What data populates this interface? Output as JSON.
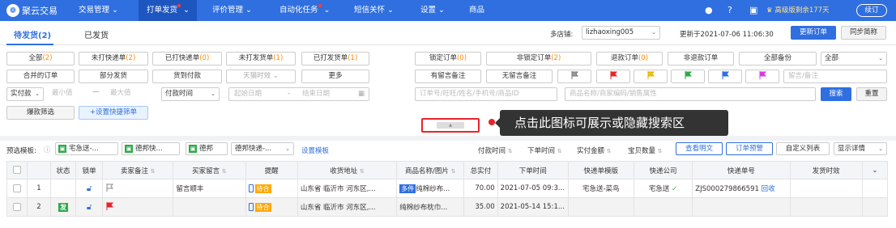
{
  "nav": {
    "logo": "聚云交易",
    "items": [
      {
        "label": "交易管理"
      },
      {
        "label": "打单发货"
      },
      {
        "label": "评价管理"
      },
      {
        "label": "自动化任务"
      },
      {
        "label": "短信关怀"
      },
      {
        "label": "设置"
      },
      {
        "label": "商品"
      }
    ],
    "promo": "高级版剩余177天",
    "renew": "续订"
  },
  "tabs": {
    "pending": "待发货(2)",
    "shipped": "已发货"
  },
  "shop": {
    "label": "多店铺:",
    "value": "lizhaoxing005",
    "updated": "更新于2021-07-06 11:06:30",
    "update_btn": "更新订单",
    "sync_btn": "同步简称"
  },
  "filters": {
    "row1_left": [
      {
        "label": "全部",
        "count": "(2)"
      },
      {
        "label": "未打快递单",
        "count": "(2)"
      },
      {
        "label": "已打快递单",
        "count": "(0)"
      },
      {
        "label": "未打发货单",
        "count": "(1)"
      },
      {
        "label": "已打发货单",
        "count": "(1)"
      }
    ],
    "row1_right": [
      {
        "label": "锁定订单",
        "count": "(0)"
      },
      {
        "label": "非锁定订单",
        "count": "(2)"
      },
      {
        "label": "退款订单",
        "count": "(0)"
      },
      {
        "label": "非退款订单",
        "count": ""
      },
      {
        "label": "全部备份",
        "count": ""
      }
    ],
    "row1_select": "全部",
    "row2_left": [
      "合并的订单",
      "部分发货",
      "货到付款",
      "天猫时效",
      "更多"
    ],
    "row2_right": [
      "有留言备注",
      "无留言备注"
    ],
    "remark_placeholder": "留言/备注",
    "actual_select": "实付款",
    "min": "最小值",
    "to": "一",
    "max": "最大值",
    "pay_time_select": "付款时间",
    "start_date": "起始日期",
    "to2": "-",
    "end_date": "结束日期",
    "order_search_placeholder": "订单号/旺旺/姓名/手机号/商品ID",
    "product_search_placeholder": "商品名称/商家编码/销售属性",
    "search_btn": "搜索",
    "reset_btn": "重置",
    "hot_filter": "爆款筛选",
    "add_quick": "+设置快捷筛单"
  },
  "tooltip": "点击此图标可展示或隐藏搜索区",
  "templates": {
    "label": "预选模板:",
    "items": [
      "宅急送-...",
      "德邦快...",
      "德邦"
    ],
    "select": "德邦快递-...",
    "setting": "设置模板"
  },
  "sort": {
    "items": [
      "付款时间",
      "下单时间",
      "实付金额",
      "宝贝数量"
    ],
    "view_plain": "查看明文",
    "order_warn": "订单预警",
    "custom_list": "自定义列表",
    "show_detail": "显示详情"
  },
  "table": {
    "headers": [
      "",
      "",
      "状态",
      "锁单",
      "卖家备注",
      "买家留言",
      "提醒",
      "收货地址",
      "商品名称/图片",
      "总实付",
      "下单时间",
      "快递单模版",
      "快递公司",
      "快递单号",
      "发货时效",
      ""
    ],
    "rows": [
      {
        "idx": "1",
        "status": "",
        "seller_note": "",
        "buyer_msg": "留言顺丰",
        "remind": "待合",
        "address": "山东省 临沂市 河东区,...",
        "multi": "多件",
        "product": "纯棉纱布...",
        "total": "70.00",
        "time": "2021-07-05 09:3...",
        "tpl": "宅急送-菜鸟",
        "company": "宅急送",
        "track": "ZJS000279866591",
        "track_action": "回收",
        "ship": ""
      },
      {
        "idx": "2",
        "status": "发",
        "seller_note": "",
        "buyer_msg": "",
        "remind": "待合",
        "address": "山东省 临沂市 河东区,...",
        "multi": "",
        "product": "纯棉纱布枕巾...",
        "total": "35.00",
        "time": "2021-05-14 15:1...",
        "tpl": "",
        "company": "",
        "track": "",
        "track_action": "",
        "ship": ""
      }
    ]
  },
  "colors": {
    "primary": "#2f6fe0",
    "danger": "#e6252b",
    "orange": "#ffa800",
    "green": "#2daa4a"
  }
}
